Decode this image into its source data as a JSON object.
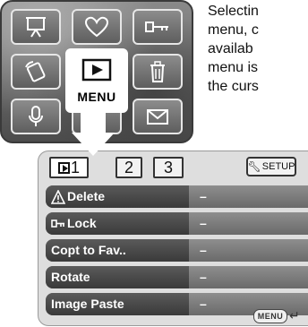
{
  "description_lines": [
    "Selectin",
    "menu, c",
    "availab",
    "menu is",
    "the curs"
  ],
  "mode_grid": {
    "selected_label": "MENU",
    "tiles": [
      {
        "icon": "slideshow-screen-icon"
      },
      {
        "icon": "heart-favorites-icon"
      },
      {
        "icon": "key-lock-icon"
      },
      {
        "icon": "rotate-camera-icon"
      },
      {
        "icon": "play-menu-icon"
      },
      {
        "icon": "trash-delete-icon"
      },
      {
        "icon": "microphone-icon"
      },
      {
        "icon": "filmstrip-icon"
      },
      {
        "icon": "envelope-mail-icon"
      }
    ]
  },
  "menu": {
    "tabs": [
      "1",
      "2",
      "3"
    ],
    "active_tab": "1",
    "setup_label": "SETUP",
    "rows": [
      {
        "label": "Delete",
        "value": "–"
      },
      {
        "label": "Lock",
        "value": "–"
      },
      {
        "label": "Copt to Fav..",
        "value": "–"
      },
      {
        "label": "Rotate",
        "value": "–"
      },
      {
        "label": "Image Paste",
        "value": "–"
      }
    ],
    "footer_button": "MENU"
  },
  "colors": {
    "row_label_bg": "#4a4a4a",
    "row_value_bg": "#7c7c7c",
    "panel_bg": "#dedede"
  }
}
